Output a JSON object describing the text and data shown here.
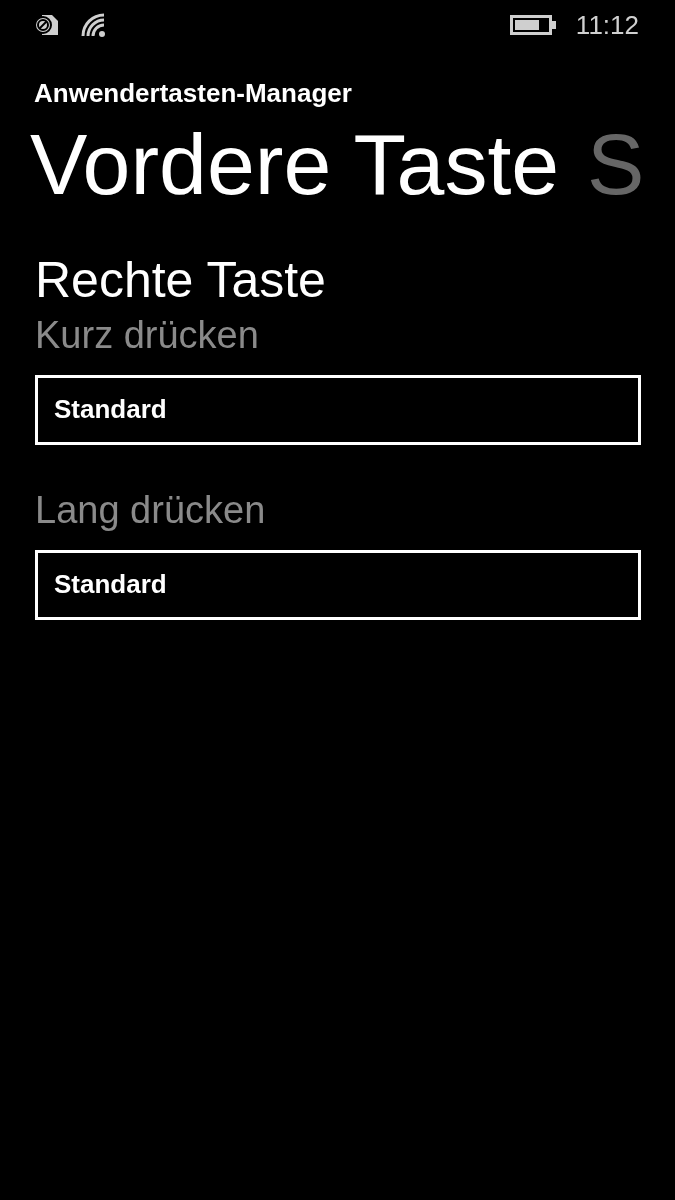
{
  "status_bar": {
    "time": "11:12"
  },
  "app_title": "Anwendertasten-Manager",
  "pivot": [
    {
      "label": "Vordere Taste",
      "selected": true
    },
    {
      "label": "S",
      "selected": false
    }
  ],
  "section_title": "Rechte Taste",
  "settings": [
    {
      "label": "Kurz drücken",
      "value": "Standard"
    },
    {
      "label": "Lang drücken",
      "value": "Standard"
    }
  ]
}
